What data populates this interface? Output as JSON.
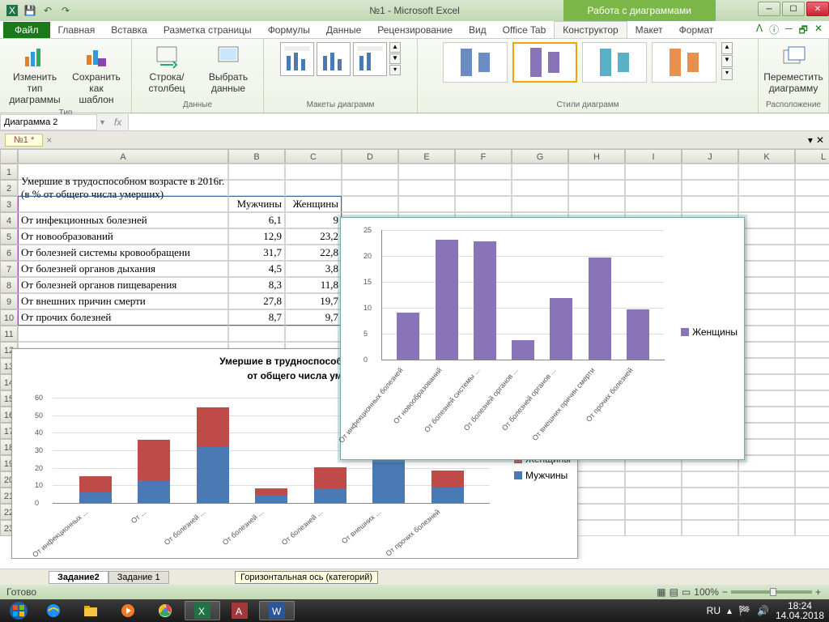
{
  "window": {
    "title": "№1 - Microsoft Excel",
    "chart_tools": "Работа с диаграммами"
  },
  "ribbon_tabs": {
    "file": "Файл",
    "t1": "Главная",
    "t2": "Вставка",
    "t3": "Разметка страницы",
    "t4": "Формулы",
    "t5": "Данные",
    "t6": "Рецензирование",
    "t7": "Вид",
    "t8": "Office Tab",
    "t9": "Конструктор",
    "t10": "Макет",
    "t11": "Формат"
  },
  "ribbon": {
    "g1": {
      "label": "Тип",
      "b1": "Изменить тип диаграммы",
      "b2": "Сохранить как шаблон"
    },
    "g2": {
      "label": "Данные",
      "b1": "Строка/столбец",
      "b2": "Выбрать данные"
    },
    "g3": {
      "label": "Макеты диаграмм"
    },
    "g4": {
      "label": "Стили диаграмм"
    },
    "g5": {
      "label": "Расположение",
      "b1": "Переместить диаграмму"
    }
  },
  "name_box": "Диаграмма 2",
  "doc_tab": "№1 *",
  "cols": {
    "A": "A",
    "B": "B",
    "C": "C",
    "D": "D",
    "E": "E",
    "F": "F",
    "G": "G",
    "H": "H",
    "I": "I",
    "J": "J",
    "K": "K",
    "L": "L"
  },
  "row_nums": [
    "1",
    "2",
    "3",
    "4",
    "5",
    "6",
    "7",
    "8",
    "9",
    "10",
    "11",
    "12",
    "13",
    "14",
    "15",
    "16",
    "17",
    "18",
    "19",
    "20",
    "21",
    "22",
    "23"
  ],
  "table": {
    "title": "Умершие в трудоспособном возрасте в 2016г.(в % от общего числа умерших)",
    "hdr_m": "Мужчины",
    "hdr_f": "Женщины",
    "rows": [
      {
        "label": "От инфекционных болезней",
        "m": "6,1",
        "f": "9"
      },
      {
        "label": "От новообразований",
        "m": "12,9",
        "f": "23,2"
      },
      {
        "label": "От болезней системы кровообращени",
        "m": "31,7",
        "f": "22,8"
      },
      {
        "label": "От болезней органов дыхания",
        "m": "4,5",
        "f": "3,8"
      },
      {
        "label": "От болезней органов пищеварения",
        "m": "8,3",
        "f": "11,8"
      },
      {
        "label": "От внешних причин смерти",
        "m": "27,8",
        "f": "19,7"
      },
      {
        "label": "От прочих болезней",
        "m": "8,7",
        "f": "9,7"
      }
    ]
  },
  "chart_data": [
    {
      "type": "bar",
      "title": "",
      "categories": [
        "От инфекционных болезней",
        "От новообразований",
        "От болезней системы ...",
        "От болезней органов ...",
        "От болезней органов ...",
        "От внешних причин смерти",
        "От прочих болезней"
      ],
      "series": [
        {
          "name": "Женщины",
          "values": [
            9,
            23.2,
            22.8,
            3.8,
            11.8,
            19.7,
            9.7
          ]
        }
      ],
      "ylim": [
        0,
        25
      ],
      "yticks": [
        0,
        5,
        10,
        15,
        20,
        25
      ],
      "color": "#8a74b8"
    },
    {
      "type": "bar",
      "stacked": true,
      "title": "Умершие в трудноспособном возрасте в 2016г. (в % от общего числа умерших)",
      "title_visible": "Умершие в трудноспособном в",
      "subtitle_visible": "от общего числа ум",
      "categories": [
        "От инфекционных ...",
        "От ...",
        "От болезней ...",
        "От болезней ...",
        "От болезней ...",
        "От внешних ...",
        "От прочих болезней"
      ],
      "series": [
        {
          "name": "Мужчины",
          "values": [
            6.1,
            12.9,
            31.7,
            4.5,
            8.3,
            27.8,
            8.7
          ],
          "color": "#4a7ab4"
        },
        {
          "name": "Женщины",
          "values": [
            9,
            23.2,
            22.8,
            3.8,
            11.8,
            19.7,
            9.7
          ],
          "color": "#be4b48"
        }
      ],
      "ylim": [
        0,
        60
      ],
      "yticks": [
        0,
        10,
        20,
        30,
        40,
        50,
        60
      ]
    }
  ],
  "legend": {
    "f": "Женщины",
    "m": "Мужчины"
  },
  "sheet_tabs": {
    "s1": "Задание2",
    "s2": "Задание 1"
  },
  "tooltip": "Горизонтальная ось (категорий)",
  "status": {
    "ready": "Готово",
    "zoom": "100%"
  },
  "tray": {
    "lang": "RU",
    "time": "18:24",
    "date": "14.04.2018"
  }
}
